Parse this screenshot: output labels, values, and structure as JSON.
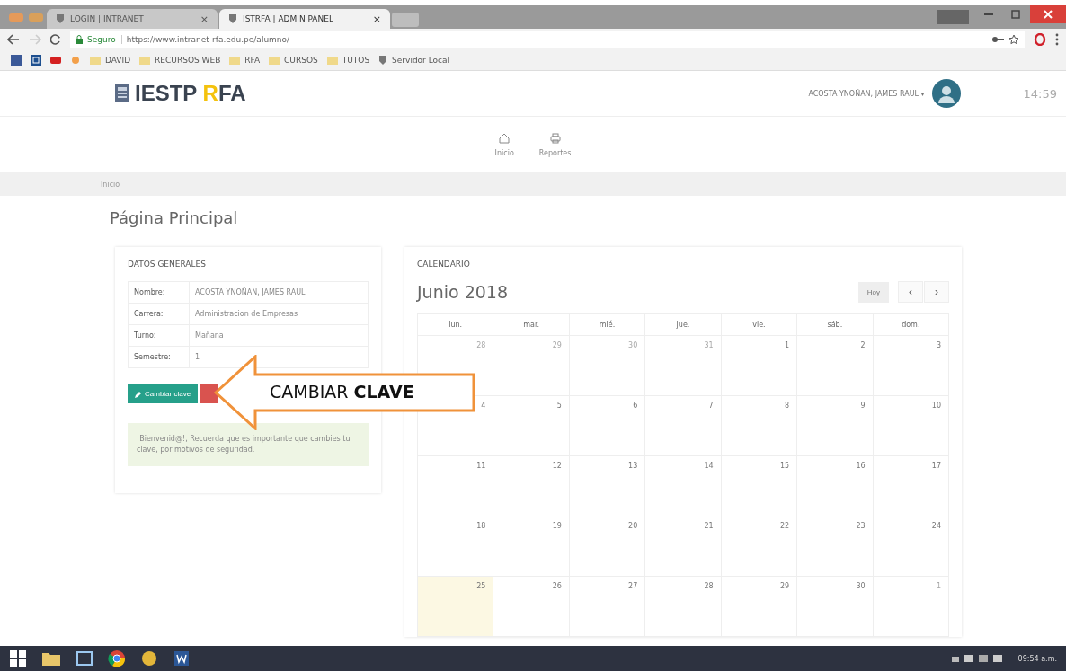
{
  "browser": {
    "tabs": [
      {
        "title": "LOGIN | INTRANET",
        "close": "×",
        "selected": false
      },
      {
        "title": "ISTRFA | ADMIN PANEL",
        "close": "×",
        "selected": true
      }
    ],
    "security": "Seguro",
    "url": "https://www.intranet-rfa.edu.pe/alumno/",
    "bookmarks": [
      {
        "label": "DAVID",
        "kind": "folder"
      },
      {
        "label": "RECURSOS WEB",
        "kind": "folder"
      },
      {
        "label": "RFA",
        "kind": "folder"
      },
      {
        "label": "CURSOS",
        "kind": "folder"
      },
      {
        "label": "TUTOS",
        "kind": "folder"
      },
      {
        "label": "Servidor Local",
        "kind": "page"
      }
    ]
  },
  "header": {
    "logo_main": "IESTP ",
    "logo_accent": "R",
    "logo_rest": "FA",
    "user": "ACOSTA YNOÑAN, JAMES RAUL ▾",
    "time": "14:59"
  },
  "nav": [
    {
      "label": "Inicio",
      "kind": "home"
    },
    {
      "label": "Reportes",
      "kind": "print"
    }
  ],
  "breadcrumb": "Inicio",
  "page_title": "Página Principal",
  "general": {
    "title": "DATOS GENERALES",
    "rows": [
      {
        "label": "Nombre:",
        "value": "ACOSTA YNOÑAN, JAMES RAUL"
      },
      {
        "label": "Carrera:",
        "value": "Administracion de Empresas"
      },
      {
        "label": "Turno:",
        "value": "Mañana"
      },
      {
        "label": "Semestre:",
        "value": "1"
      }
    ],
    "button": "Cambiar clave",
    "notice": "¡Bienvenid@!, Recuerda que es importante que cambies tu clave, por motivos de seguridad."
  },
  "calendar": {
    "title": "CALENDARIO",
    "month": "Junio 2018",
    "today_button": "Hoy",
    "prev": "‹",
    "next": "›",
    "weekdays": [
      "lun.",
      "mar.",
      "mié.",
      "jue.",
      "vie.",
      "sáb.",
      "dom."
    ],
    "weeks": [
      [
        {
          "day": "28",
          "other_month": true,
          "today": false
        },
        {
          "day": "29",
          "other_month": true,
          "today": false
        },
        {
          "day": "30",
          "other_month": true,
          "today": false
        },
        {
          "day": "31",
          "other_month": true,
          "today": false
        },
        {
          "day": "1",
          "other_month": false,
          "today": false
        },
        {
          "day": "2",
          "other_month": false,
          "today": false
        },
        {
          "day": "3",
          "other_month": false,
          "today": false
        }
      ],
      [
        {
          "day": "4",
          "other_month": false,
          "today": false
        },
        {
          "day": "5",
          "other_month": false,
          "today": false
        },
        {
          "day": "6",
          "other_month": false,
          "today": false
        },
        {
          "day": "7",
          "other_month": false,
          "today": false
        },
        {
          "day": "8",
          "other_month": false,
          "today": false
        },
        {
          "day": "9",
          "other_month": false,
          "today": false
        },
        {
          "day": "10",
          "other_month": false,
          "today": false
        }
      ],
      [
        {
          "day": "11",
          "other_month": false,
          "today": false
        },
        {
          "day": "12",
          "other_month": false,
          "today": false
        },
        {
          "day": "13",
          "other_month": false,
          "today": false
        },
        {
          "day": "14",
          "other_month": false,
          "today": false
        },
        {
          "day": "15",
          "other_month": false,
          "today": false
        },
        {
          "day": "16",
          "other_month": false,
          "today": false
        },
        {
          "day": "17",
          "other_month": false,
          "today": false
        }
      ],
      [
        {
          "day": "18",
          "other_month": false,
          "today": false
        },
        {
          "day": "19",
          "other_month": false,
          "today": false
        },
        {
          "day": "20",
          "other_month": false,
          "today": false
        },
        {
          "day": "21",
          "other_month": false,
          "today": false
        },
        {
          "day": "22",
          "other_month": false,
          "today": false
        },
        {
          "day": "23",
          "other_month": false,
          "today": false
        },
        {
          "day": "24",
          "other_month": false,
          "today": false
        }
      ],
      [
        {
          "day": "25",
          "other_month": false,
          "today": true
        },
        {
          "day": "26",
          "other_month": false,
          "today": false
        },
        {
          "day": "27",
          "other_month": false,
          "today": false
        },
        {
          "day": "28",
          "other_month": false,
          "today": false
        },
        {
          "day": "29",
          "other_month": false,
          "today": false
        },
        {
          "day": "30",
          "other_month": false,
          "today": false
        },
        {
          "day": "1",
          "other_month": true,
          "today": false
        }
      ]
    ]
  },
  "callout": "CAMBIAR **CLAVE**",
  "taskbar": {
    "clock": "09:54 a.m."
  }
}
